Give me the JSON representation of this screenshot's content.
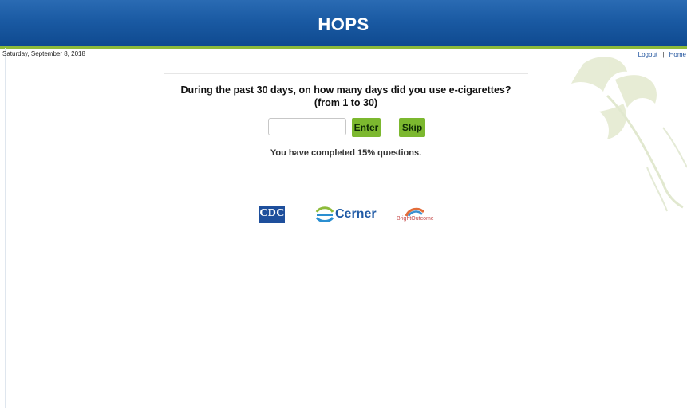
{
  "header": {
    "title": "HOPS"
  },
  "topbar": {
    "date": "Saturday, September 8, 2018",
    "logout_label": "Logout",
    "separator": "|",
    "home_label": "Home"
  },
  "question": {
    "line1": "During the past 30 days, on how many days did you use e-cigarettes?",
    "line2": "(from 1 to 30)",
    "input_value": "",
    "enter_label": "Enter",
    "skip_label": "Skip",
    "progress_text": "You have completed 15% questions.",
    "progress_percent": 15
  },
  "logos": {
    "cdc": "CDC",
    "cerner": "Cerner",
    "brightoutcome": "BrightOutcome"
  },
  "colors": {
    "header_blue": "#1a5aa3",
    "accent_green": "#7cb82f",
    "link_blue": "#1a4f9c"
  }
}
